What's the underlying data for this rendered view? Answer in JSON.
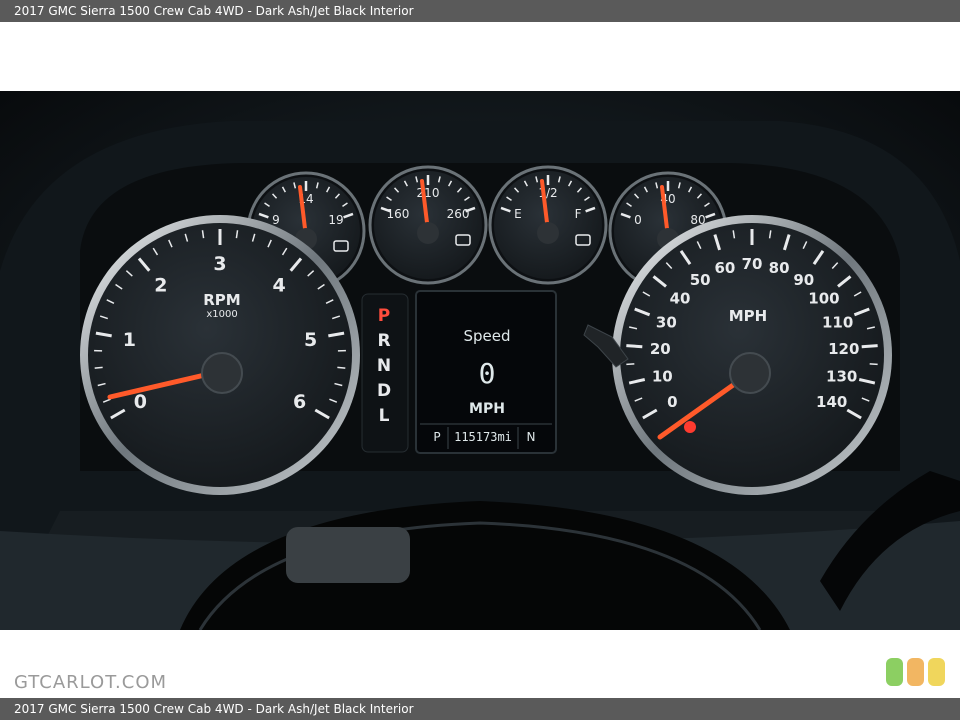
{
  "caption": {
    "title": "2017 GMC Sierra 1500 Crew Cab 4WD - Dark Ash/Jet Black Interior",
    "footer": "2017 GMC Sierra 1500 Crew Cab 4WD - Dark Ash/Jet Black Interior"
  },
  "watermark": "GTCARLOT.COM",
  "colors": {
    "needle": "#ff5a2a",
    "tick": "#e8eaec",
    "display_text": "#dfe8ea",
    "gear_active": "#ff4d3d",
    "badge_green": "#8ccf62",
    "badge_orange": "#f2b662",
    "badge_yellow": "#f0d65c"
  },
  "tachometer": {
    "labels": [
      "0",
      "1",
      "2",
      "3",
      "4",
      "5",
      "6"
    ],
    "unit": "RPM",
    "multiplier": "x1000",
    "value": 0.7
  },
  "speedometer": {
    "labels": [
      "0",
      "10",
      "20",
      "30",
      "40",
      "50",
      "60",
      "70",
      "80",
      "90",
      "100",
      "110",
      "120",
      "130",
      "140"
    ],
    "unit": "MPH",
    "value": 0
  },
  "small_gauges": [
    {
      "name": "voltage",
      "labels": [
        "9",
        "14",
        "19"
      ],
      "icon": "battery-icon"
    },
    {
      "name": "coolant-temperature",
      "labels": [
        "160",
        "210",
        "260"
      ],
      "icon": "coolant-icon"
    },
    {
      "name": "fuel",
      "labels": [
        "E",
        "1/2",
        "F"
      ],
      "icon": "fuel-icon"
    },
    {
      "name": "oil-pressure",
      "labels": [
        "0",
        "40",
        "80"
      ],
      "icon": "oil-can-icon"
    }
  ],
  "gear_selector": {
    "gears": [
      "P",
      "R",
      "N",
      "D",
      "L"
    ],
    "active": "P"
  },
  "center_display": {
    "heading": "Speed",
    "value": "0",
    "unit": "MPH",
    "gear": "P",
    "odometer": "115173mi",
    "mode": "N"
  }
}
